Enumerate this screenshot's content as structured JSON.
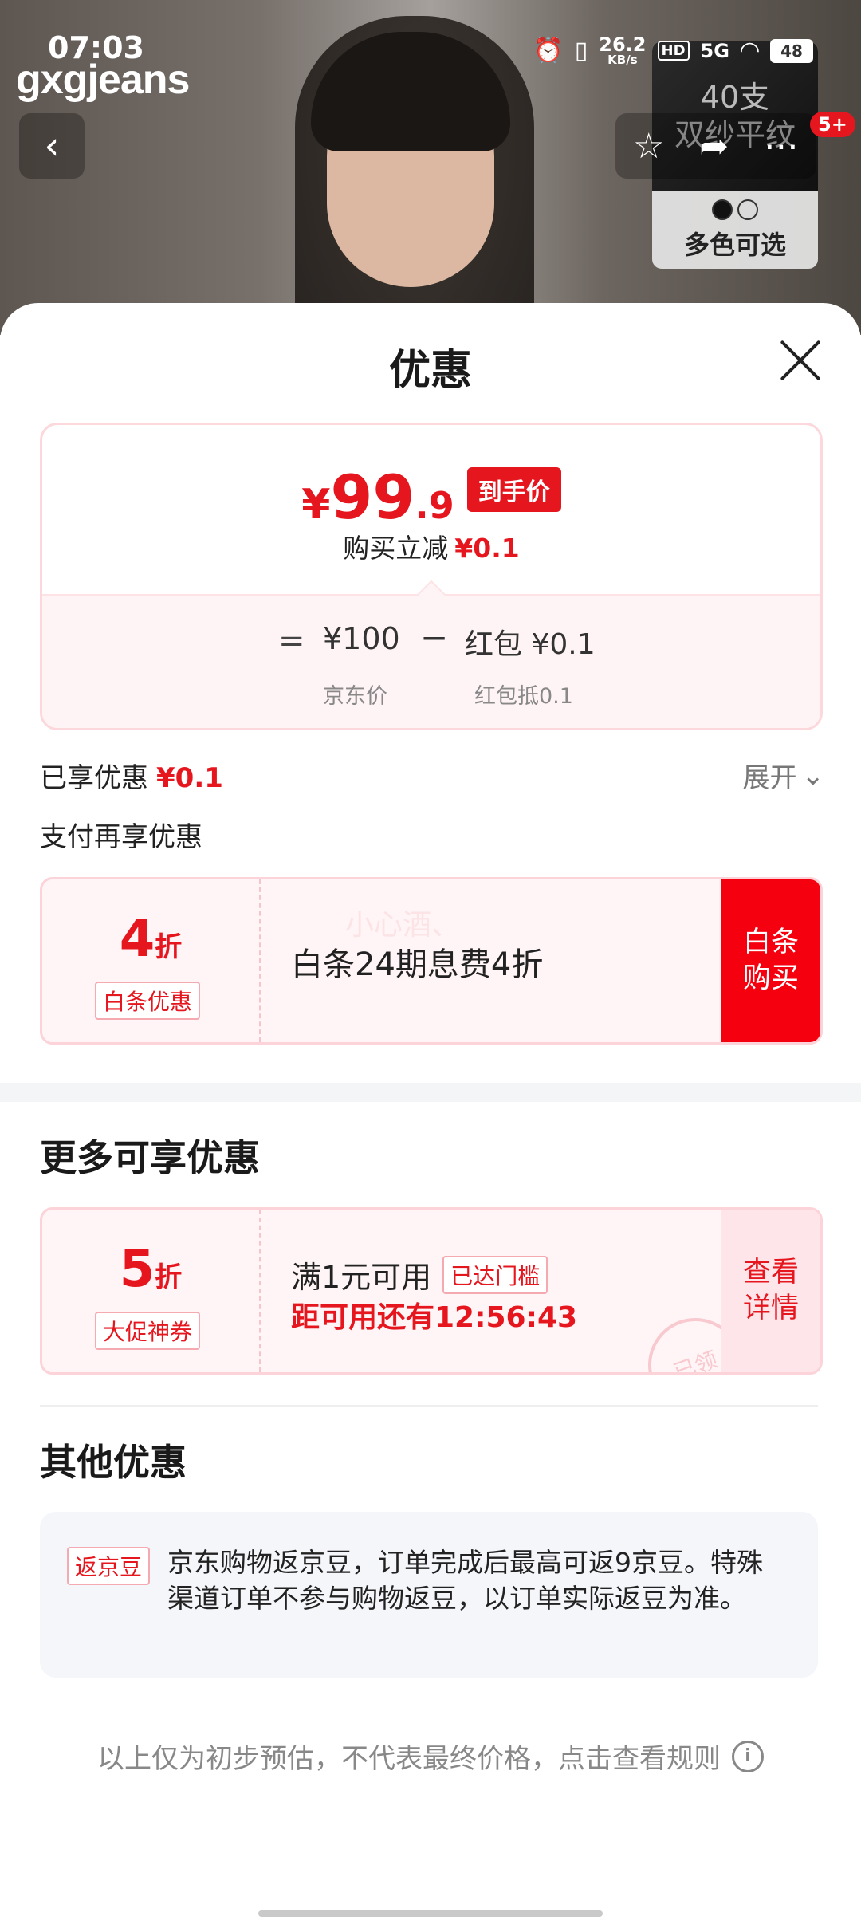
{
  "status_bar": {
    "time": "07:03",
    "net_speed": "26.2",
    "net_unit": "KB/s",
    "hd": "HD",
    "signal": "5G",
    "battery": "48"
  },
  "hero": {
    "brand": "gxgjeans",
    "cart_badge": "5+",
    "swatch": {
      "line1": "40支",
      "line2": "双纱平纹",
      "label": "多色可选"
    }
  },
  "sheet": {
    "title": "优惠",
    "price_card": {
      "yen": "¥",
      "price_int": "99",
      "price_dec": ".9",
      "price_tag": "到手价",
      "reduce_label": "购买立减",
      "reduce_value": "¥0.1",
      "eq": "=",
      "jd_price": "¥100",
      "minus": "−",
      "redpacket": "红包 ¥0.1",
      "jd_price_caption": "京东价",
      "redpacket_caption": "红包抵0.1"
    },
    "enjoyed_label": "已享优惠",
    "enjoyed_value": "¥0.1",
    "expand_label": "展开",
    "pay_more_label": "支付再享优惠",
    "baitiao_coupon": {
      "disc_big": "4",
      "disc_small": "折",
      "tag": "白条优惠",
      "desc": "白条24期息费4折",
      "watermark": "小心酒、",
      "button": "白条\n购买"
    },
    "more_section_title": "更多可享优惠",
    "promo_coupon": {
      "disc_big": "5",
      "disc_small": "折",
      "tag": "大促神券",
      "condition": "满1元可用",
      "reached": "已达门槛",
      "countdown": "距可用还有12:56:43",
      "stamp": "已领",
      "button": "查看\n详情"
    },
    "other_section_title": "其他优惠",
    "jingdou": {
      "tag": "返京豆",
      "text": "京东购物返京豆，订单完成后最高可返9京豆。特殊渠道订单不参与购物返豆，以订单实际返豆为准。"
    },
    "footer_note": "以上仅为初步预估，不代表最终价格，点击查看规则"
  },
  "colors": {
    "accent_red": "#e6161e",
    "button_red": "#f5000f",
    "coupon_bg": "#fff5f6"
  }
}
